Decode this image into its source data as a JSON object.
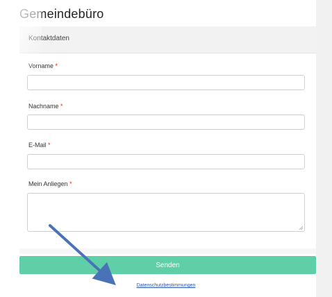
{
  "page": {
    "title": "Gemeindebüro"
  },
  "form": {
    "section_title": "Kontaktdaten",
    "fields": [
      {
        "label": "Vorname",
        "required_mark": "*",
        "value": ""
      },
      {
        "label": "Nachname",
        "required_mark": "*",
        "value": ""
      },
      {
        "label": "E-Mail",
        "required_mark": "*",
        "value": ""
      },
      {
        "label": "Mein Anliegen",
        "required_mark": "*",
        "value": ""
      }
    ],
    "submit_label": "Senden",
    "privacy_link": "Datenschutzbestimmungen"
  },
  "colors": {
    "submit_button": "#5fcfa7",
    "required_mark": "#e2241a",
    "link": "#2a57b8",
    "annotation_arrow": "#4a72b8"
  },
  "icons": {
    "resize_grip": "resize-grip-icon",
    "annotation": "arrow-pointer-icon"
  }
}
